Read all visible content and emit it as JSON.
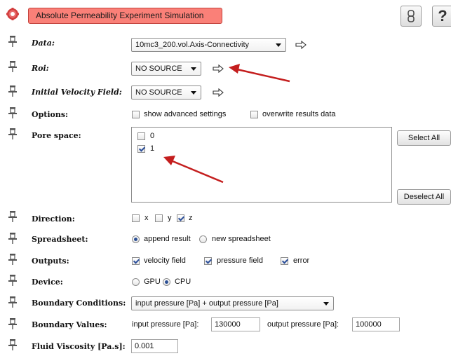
{
  "module": {
    "title": "Absolute Permeability Experiment Simulation",
    "help_label": "?",
    "icons": {
      "module": "gear-icon",
      "link": "chain-link-icon",
      "pin": "pushpin-icon",
      "connect": "connect-arrow-icon"
    }
  },
  "ports": {
    "data": {
      "label": "Data:",
      "value": "10mc3_200.vol.Axis-Connectivity"
    },
    "roi": {
      "label": "Roi:",
      "value": "NO SOURCE"
    },
    "velocity": {
      "label": "Initial Velocity Field:",
      "value": "NO SOURCE"
    }
  },
  "options": {
    "label": "Options:",
    "items": [
      {
        "label": "show advanced settings",
        "checked": false
      },
      {
        "label": "overwrite results data",
        "checked": false
      }
    ]
  },
  "pore_space": {
    "label": "Pore space:",
    "items": [
      {
        "label": "0",
        "checked": false
      },
      {
        "label": "1",
        "checked": true
      }
    ],
    "select_all_label": "Select All",
    "deselect_all_label": "Deselect All"
  },
  "direction": {
    "label": "Direction:",
    "items": [
      {
        "label": "x",
        "checked": false
      },
      {
        "label": "y",
        "checked": false
      },
      {
        "label": "z",
        "checked": true
      }
    ]
  },
  "spreadsheet": {
    "label": "Spreadsheet:",
    "items": [
      {
        "label": "append result",
        "selected": true
      },
      {
        "label": "new spreadsheet",
        "selected": false
      }
    ]
  },
  "outputs": {
    "label": "Outputs:",
    "items": [
      {
        "label": "velocity field",
        "checked": true
      },
      {
        "label": "pressure field",
        "checked": true
      },
      {
        "label": "error",
        "checked": true
      }
    ]
  },
  "device": {
    "label": "Device:",
    "items": [
      {
        "label": "GPU",
        "selected": false
      },
      {
        "label": "CPU",
        "selected": true
      }
    ]
  },
  "boundary_conditions": {
    "label": "Boundary Conditions:",
    "value": "input pressure [Pa] + output pressure [Pa]"
  },
  "boundary_values": {
    "label": "Boundary Values:",
    "input_label": "input pressure [Pa]:",
    "input_value": "130000",
    "output_label": "output pressure [Pa]:",
    "output_value": "100000"
  },
  "viscosity": {
    "label": "Fluid Viscosity [Pa.s]:",
    "value": "0.001"
  },
  "colors": {
    "title_bg": "#fa8078",
    "annotation_arrow": "#c41e1e",
    "check_mark": "#2c4f9a"
  }
}
